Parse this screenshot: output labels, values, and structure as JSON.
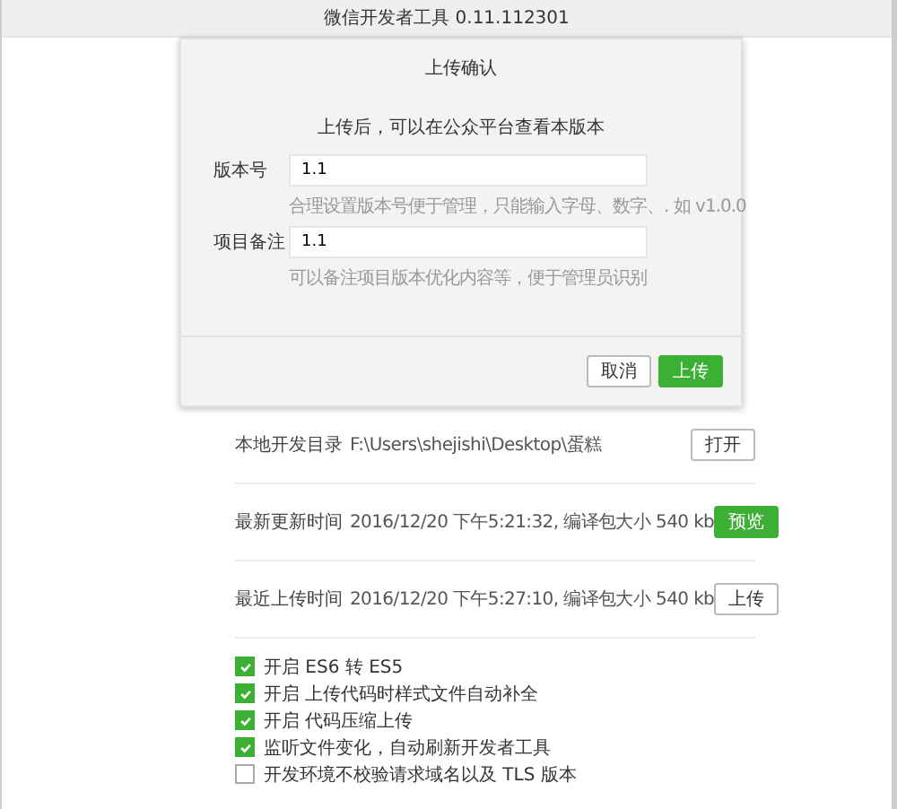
{
  "window": {
    "title": "微信开发者工具 0.11.112301"
  },
  "dialog": {
    "title": "上传确认",
    "message": "上传后，可以在公众平台查看本版本",
    "fields": [
      {
        "label": "版本号",
        "value": "1.1",
        "hint": "合理设置版本号便于管理，只能输入字母、数字、. 如 v1.0.0"
      },
      {
        "label": "项目备注",
        "value": "1.1",
        "hint": "可以备注项目版本优化内容等，便于管理员识别"
      }
    ],
    "buttons": [
      {
        "label": "取消",
        "kind": "secondary"
      },
      {
        "label": "上传",
        "kind": "primary"
      }
    ]
  },
  "info_rows": [
    {
      "label": "本地开发目录",
      "value": "F:\\Users\\shejishi\\Desktop\\蛋糕",
      "button": {
        "label": "打开",
        "kind": "secondary"
      }
    },
    {
      "label": "最新更新时间",
      "value": "2016/12/20 下午5:21:32, 编译包大小 540 kb",
      "button": {
        "label": "预览",
        "kind": "primary"
      }
    },
    {
      "label": "最近上传时间",
      "value": "2016/12/20 下午5:27:10, 编译包大小 540 kb",
      "button": {
        "label": "上传",
        "kind": "secondary"
      }
    }
  ],
  "options": [
    {
      "label": "开启 ES6 转 ES5",
      "checked": true
    },
    {
      "label": "开启 上传代码时样式文件自动补全",
      "checked": true
    },
    {
      "label": "开启 代码压缩上传",
      "checked": true
    },
    {
      "label": "监听文件变化，自动刷新开发者工具",
      "checked": true
    },
    {
      "label": "开发环境不校验请求域名以及 TLS 版本",
      "checked": false
    }
  ]
}
